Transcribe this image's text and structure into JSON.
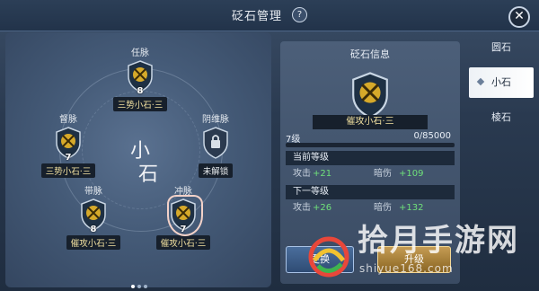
{
  "header": {
    "title": "砭石管理",
    "help": "?",
    "close": "✕"
  },
  "meridian_map": {
    "center_chars": [
      "小",
      "石"
    ],
    "nodes": [
      {
        "name": "任脉",
        "level": "8",
        "gem": "三势小石·三"
      },
      {
        "name": "督脉",
        "level": "7",
        "gem": "三势小石·三"
      },
      {
        "name": "阴维脉",
        "level": "",
        "gem": "未解锁"
      },
      {
        "name": "带脉",
        "level": "8",
        "gem": "催攻小石·三"
      },
      {
        "name": "冲脉",
        "level": "7",
        "gem": "催攻小石·三"
      }
    ]
  },
  "info": {
    "title": "砭石信息",
    "gem_name": "催攻小石·三",
    "level_label": "7级",
    "exp_current": "0",
    "exp_max": "85000",
    "exp_text": "0/85000",
    "exp_fraction": 0,
    "current_header": "当前等级",
    "current": {
      "atk_label": "攻击",
      "atk_value": "+21",
      "crit_label": "暗伤",
      "crit_value": "+109"
    },
    "next_header": "下一等级",
    "next": {
      "atk_label": "攻击",
      "atk_value": "+26",
      "crit_label": "暗伤",
      "crit_value": "+132"
    }
  },
  "buttons": {
    "replace": "更换",
    "upgrade": "升级"
  },
  "tabs": [
    {
      "label": "圆石",
      "active": false
    },
    {
      "label": "小石",
      "active": true
    },
    {
      "label": "棱石",
      "active": false
    }
  ],
  "watermark": {
    "text": "拾月手游网",
    "url": "shiyue168.com"
  },
  "colors": {
    "gem_label": "#f2e1a0",
    "stat_value": "#6fe07a",
    "selected_halo": "#f3d2c9"
  }
}
